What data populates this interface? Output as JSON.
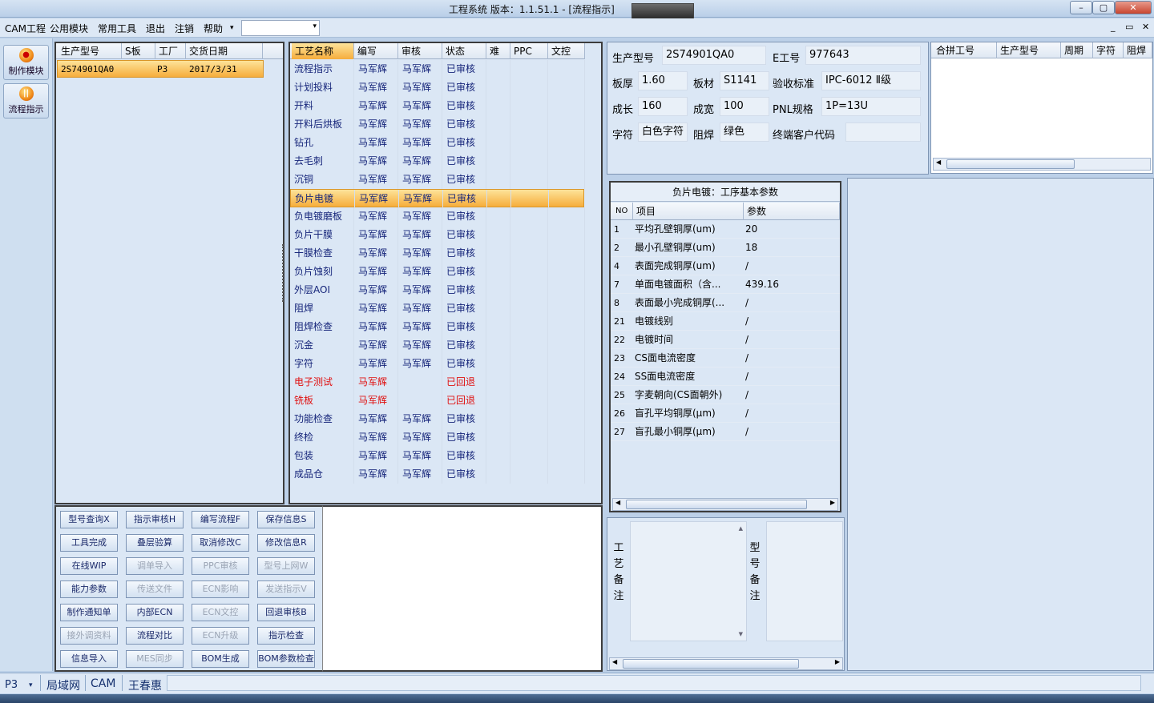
{
  "window": {
    "title": "工程系统    版本：1.1.51.1 - [流程指示]",
    "controls": {
      "minimize": "–",
      "maximize": "▢",
      "close": "✕"
    }
  },
  "menu": {
    "items": [
      "CAM工程",
      "公用模块",
      "常用工具",
      "退出",
      "注销",
      "帮助"
    ],
    "help_arrow": "▾",
    "combo_value": "",
    "mdi": {
      "minimize": "_",
      "restore": "▭",
      "close": "✕"
    }
  },
  "sidebar": {
    "items": [
      {
        "label": "制作模块",
        "icon": "flame-icon"
      },
      {
        "label": "流程指示",
        "icon": "pause-icon"
      }
    ]
  },
  "product_list": {
    "headers": [
      "生产型号",
      "S板",
      "工厂",
      "交货日期"
    ],
    "rows": [
      {
        "model": "2S74901QA0",
        "board": "",
        "factory": "P3",
        "date": "2017/3/31"
      }
    ]
  },
  "process_list": {
    "headers": [
      "工艺名称",
      "编写",
      "审核",
      "状态",
      "难",
      "PPC",
      "文控"
    ],
    "rows": [
      {
        "name": "流程指示",
        "writer": "马军辉",
        "reviewer": "马军辉",
        "status": "已审核"
      },
      {
        "name": "计划投料",
        "writer": "马军辉",
        "reviewer": "马军辉",
        "status": "已审核"
      },
      {
        "name": "开料",
        "writer": "马军辉",
        "reviewer": "马军辉",
        "status": "已审核"
      },
      {
        "name": "开料后烘板",
        "writer": "马军辉",
        "reviewer": "马军辉",
        "status": "已审核"
      },
      {
        "name": "钻孔",
        "writer": "马军辉",
        "reviewer": "马军辉",
        "status": "已审核"
      },
      {
        "name": "去毛刺",
        "writer": "马军辉",
        "reviewer": "马军辉",
        "status": "已审核"
      },
      {
        "name": "沉铜",
        "writer": "马军辉",
        "reviewer": "马军辉",
        "status": "已审核"
      },
      {
        "name": "负片电镀",
        "writer": "马军辉",
        "reviewer": "马军辉",
        "status": "已审核",
        "selected": true
      },
      {
        "name": "负电镀磨板",
        "writer": "马军辉",
        "reviewer": "马军辉",
        "status": "已审核"
      },
      {
        "name": "负片干膜",
        "writer": "马军辉",
        "reviewer": "马军辉",
        "status": "已审核"
      },
      {
        "name": "干膜检查",
        "writer": "马军辉",
        "reviewer": "马军辉",
        "status": "已审核"
      },
      {
        "name": "负片蚀刻",
        "writer": "马军辉",
        "reviewer": "马军辉",
        "status": "已审核"
      },
      {
        "name": "外层AOI",
        "writer": "马军辉",
        "reviewer": "马军辉",
        "status": "已审核"
      },
      {
        "name": "阻焊",
        "writer": "马军辉",
        "reviewer": "马军辉",
        "status": "已审核"
      },
      {
        "name": "阻焊检查",
        "writer": "马军辉",
        "reviewer": "马军辉",
        "status": "已审核"
      },
      {
        "name": "沉金",
        "writer": "马军辉",
        "reviewer": "马军辉",
        "status": "已审核"
      },
      {
        "name": "字符",
        "writer": "马军辉",
        "reviewer": "马军辉",
        "status": "已审核"
      },
      {
        "name": "电子测试",
        "writer": "马军辉",
        "reviewer": "",
        "status": "已回退",
        "returned": true
      },
      {
        "name": "铣板",
        "writer": "马军辉",
        "reviewer": "",
        "status": "已回退",
        "returned": true
      },
      {
        "name": "功能检查",
        "writer": "马军辉",
        "reviewer": "马军辉",
        "status": "已审核"
      },
      {
        "name": "终检",
        "writer": "马军辉",
        "reviewer": "马军辉",
        "status": "已审核"
      },
      {
        "name": "包装",
        "writer": "马军辉",
        "reviewer": "马军辉",
        "status": "已审核"
      },
      {
        "name": "成品仓",
        "writer": "马军辉",
        "reviewer": "马军辉",
        "status": "已审核"
      }
    ]
  },
  "actions": {
    "buttons": [
      [
        {
          "label": "型号查询X",
          "enabled": true
        },
        {
          "label": "指示审核H",
          "enabled": true
        },
        {
          "label": "编写流程F",
          "enabled": true
        },
        {
          "label": "保存信息S",
          "enabled": true
        }
      ],
      [
        {
          "label": "工具完成",
          "enabled": true
        },
        {
          "label": "叠层验算",
          "enabled": true
        },
        {
          "label": "取消修改C",
          "enabled": true
        },
        {
          "label": "修改信息R",
          "enabled": true
        }
      ],
      [
        {
          "label": "在线WIP",
          "enabled": true
        },
        {
          "label": "调单导入",
          "enabled": false
        },
        {
          "label": "PPC审核",
          "enabled": false
        },
        {
          "label": "型号上网W",
          "enabled": false
        }
      ],
      [
        {
          "label": "能力参数",
          "enabled": true
        },
        {
          "label": "传送文件",
          "enabled": false
        },
        {
          "label": "ECN影响",
          "enabled": false
        },
        {
          "label": "发送指示V",
          "enabled": false
        }
      ],
      [
        {
          "label": "制作通知单",
          "enabled": true
        },
        {
          "label": "内部ECN",
          "enabled": true
        },
        {
          "label": "ECN文控",
          "enabled": false
        },
        {
          "label": "回退审核B",
          "enabled": true
        }
      ],
      [
        {
          "label": "接外调资料",
          "enabled": false
        },
        {
          "label": "流程对比",
          "enabled": true
        },
        {
          "label": "ECN升级",
          "enabled": false
        },
        {
          "label": "指示检查",
          "enabled": true
        }
      ],
      [
        {
          "label": "信息导入",
          "enabled": true
        },
        {
          "label": "MES同步",
          "enabled": false
        },
        {
          "label": "BOM生成",
          "enabled": true
        },
        {
          "label": "BOM参数检查",
          "enabled": true
        }
      ]
    ]
  },
  "info": {
    "production_model_label": "生产型号",
    "production_model": "2S74901QA0",
    "e_work_label": "E工号",
    "e_work": "977643",
    "thickness_label": "板厚",
    "thickness": "1.60",
    "material_label": "板材",
    "material": "S1141",
    "standard_label": "验收标准",
    "standard": "IPC-6012 Ⅱ级",
    "length_label": "成长",
    "length": "160",
    "width_label": "成宽",
    "width": "100",
    "pnl_label": "PNL规格",
    "pnl": "1P=13U",
    "char_label": "字符",
    "char": "白色字符",
    "mask_label": "阻焊",
    "mask": "绿色",
    "customer_label": "终端客户代码",
    "customer": ""
  },
  "panel_table": {
    "headers": [
      "合拼工号",
      "生产型号",
      "周期",
      "字符",
      "阻焊"
    ]
  },
  "params": {
    "title": "负片电镀：工序基本参数",
    "headers": [
      "NO",
      "项目",
      "参数"
    ],
    "rows": [
      {
        "no": "1",
        "item": "平均孔壁铜厚(um)",
        "value": "20"
      },
      {
        "no": "2",
        "item": "最小孔壁铜厚(um)",
        "value": "18"
      },
      {
        "no": "4",
        "item": "表面完成铜厚(um)",
        "value": "/"
      },
      {
        "no": "7",
        "item": "单面电镀面积（含...",
        "value": "439.16"
      },
      {
        "no": "8",
        "item": "表面最小完成铜厚(...",
        "value": "/"
      },
      {
        "no": "21",
        "item": "电镀线别",
        "value": "/"
      },
      {
        "no": "22",
        "item": "电镀时间",
        "value": "/"
      },
      {
        "no": "23",
        "item": "CS面电流密度",
        "value": "/"
      },
      {
        "no": "24",
        "item": "SS面电流密度",
        "value": "/"
      },
      {
        "no": "25",
        "item": "字麦朝向(CS面朝外)",
        "value": "/"
      },
      {
        "no": "26",
        "item": "盲孔平均铜厚(μm)",
        "value": "/"
      },
      {
        "no": "27",
        "item": "盲孔最小铜厚(μm)",
        "value": "/"
      }
    ]
  },
  "remarks": {
    "process_label": "工艺备注",
    "model_label": "型号备注",
    "process_text": "",
    "model_text": ""
  },
  "status": {
    "factory": "P3",
    "network": "局域网",
    "module": "CAM",
    "user": "王春惠"
  },
  "colors": {
    "selected_row": "#f6ad3c",
    "returned_text": "#e01010",
    "link_text": "#16257a"
  }
}
